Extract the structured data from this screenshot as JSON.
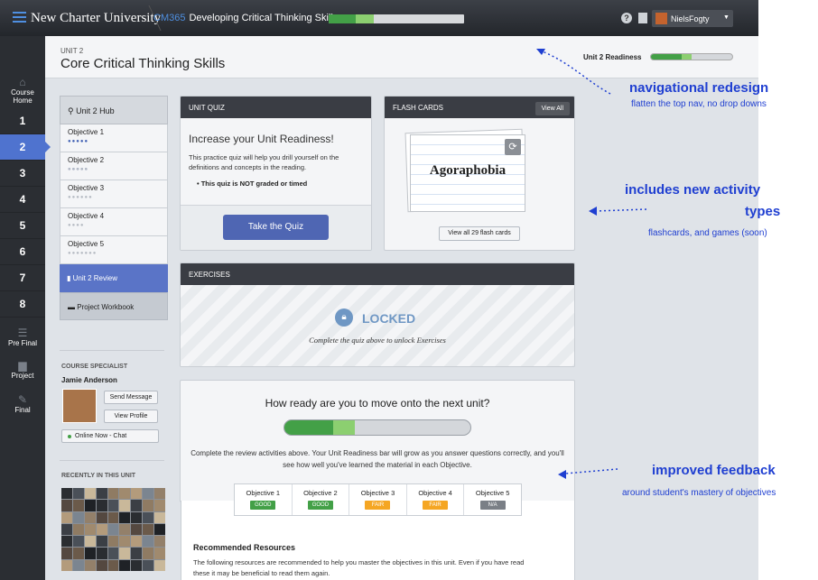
{
  "topbar": {
    "brand": "New Charter University",
    "course_code": "CM365",
    "course_name": "Developing Critical Thinking Skills",
    "progress": {
      "mastered": 0.2,
      "in_progress": 0.13
    },
    "user": "NielsFogty",
    "menu_icon": "hamburger-icon",
    "help_icon": "help-icon",
    "doc_icon": "document-icon"
  },
  "sidenav": {
    "home": "Course Home",
    "units": [
      "1",
      "2",
      "3",
      "4",
      "5",
      "6",
      "7",
      "8"
    ],
    "active_unit": "2",
    "pre_final": "Pre Final",
    "project": "Project",
    "final": "Final"
  },
  "page": {
    "unit_label": "UNIT 2",
    "title": "Core Critical Thinking Skills",
    "readiness_label": "Unit 2 Readiness",
    "readiness": {
      "mastered": 0.38,
      "in_progress": 0.12
    }
  },
  "left": {
    "hub": "Unit 2 Hub",
    "objectives": [
      {
        "label": "Objective 1",
        "dots": "●●●●●"
      },
      {
        "label": "Objective 2",
        "dots": "●●●●●"
      },
      {
        "label": "Objective 3",
        "dots": "●●●●●●"
      },
      {
        "label": "Objective 4",
        "dots": "●●●●"
      },
      {
        "label": "Objective 5",
        "dots": "●●●●●●●"
      }
    ],
    "review": "Unit 2 Review",
    "workbook": "Project Workbook",
    "specialist_label": "COURSE SPECIALIST",
    "specialist_name": "Jamie Anderson",
    "send_message": "Send Message",
    "view_profile": "View Profile",
    "online": "Online Now - Chat",
    "recent_label": "RECENTLY IN THIS UNIT"
  },
  "quiz": {
    "header": "UNIT QUIZ",
    "headline": "Increase your Unit Readiness!",
    "body": "This practice quiz will help you drill yourself on the definitions and concepts in the reading.",
    "note": "• This quiz is NOT graded or timed",
    "button": "Take the Quiz"
  },
  "flashcards": {
    "header": "FLASH CARDS",
    "view_all": "View All",
    "word": "Agoraphobia",
    "view_all_count": "View all 29 flash cards"
  },
  "exercises": {
    "header": "EXERCISES",
    "locked": "LOCKED",
    "message": "Complete the quiz above to unlock Exercises"
  },
  "readiness": {
    "question": "How ready are you to move onto the next unit?",
    "bar": {
      "mastered": 0.26,
      "in_progress": 0.12
    },
    "body": "Complete the review activities above. Your Unit Readiness bar will grow as you answer questions correctly, and you'll see how well you've learned the material in each Objective.",
    "objectives": [
      {
        "label": "Objective 1",
        "status": "GOOD",
        "color": "#43a047"
      },
      {
        "label": "Objective 2",
        "status": "GOOD",
        "color": "#43a047"
      },
      {
        "label": "Objective 3",
        "status": "FAIR",
        "color": "#f5a623"
      },
      {
        "label": "Objective 4",
        "status": "FAIR",
        "color": "#f5a623"
      },
      {
        "label": "Objective 5",
        "status": "N/A",
        "color": "#7a7f86"
      }
    ]
  },
  "resources": {
    "title": "Recommended Resources",
    "body": "The following resources are recommended to help you master the objectives in this unit. Even if you have read these it may be beneficial to read them again."
  },
  "annotations": {
    "nav_title": "navigational redesign",
    "nav_sub": "flatten the top nav, no drop downs",
    "act_title1": "includes new activity",
    "act_title2": "types",
    "act_sub": "flashcards, and games (soon)",
    "fb_title": "improved feedback",
    "fb_sub": "around student's mastery of objectives",
    "color": "#1f3fd1"
  }
}
